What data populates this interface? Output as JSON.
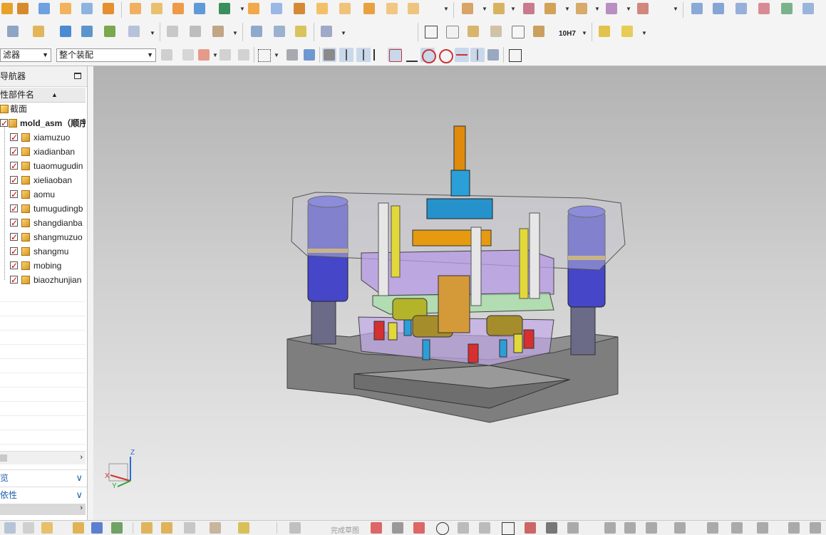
{
  "toolbar": {
    "filter_select": "滤器",
    "assembly_select": "整个装配",
    "tolerance_label": "10H7"
  },
  "navigator": {
    "title": "导航器",
    "column_header": "性部件名",
    "items": [
      {
        "label": "截面"
      },
      {
        "label": "mold_asm（顺序"
      },
      {
        "label": "xiamuzuo"
      },
      {
        "label": "xiadianban"
      },
      {
        "label": "tuaomugudin"
      },
      {
        "label": "xieliaoban"
      },
      {
        "label": "aomu"
      },
      {
        "label": "tumugudingb"
      },
      {
        "label": "shangdianba"
      },
      {
        "label": "shangmuzuo"
      },
      {
        "label": "shangmu"
      },
      {
        "label": "mobing"
      },
      {
        "label": "biaozhunjian"
      }
    ],
    "panels": [
      {
        "label": "览"
      },
      {
        "label": "依性"
      }
    ]
  },
  "statusbar": {
    "hint": "完成草图"
  },
  "axes": {
    "x": "X",
    "y": "Y",
    "z": "Z"
  },
  "colors": {
    "viewport_top": "#b2b2b2",
    "viewport_bottom": "#ececec",
    "check_red": "#cc0000",
    "part_blue": "#4a56d4",
    "part_orange": "#e59a10",
    "part_cyan": "#2a9fd8",
    "part_purple": "#b79ae6"
  }
}
